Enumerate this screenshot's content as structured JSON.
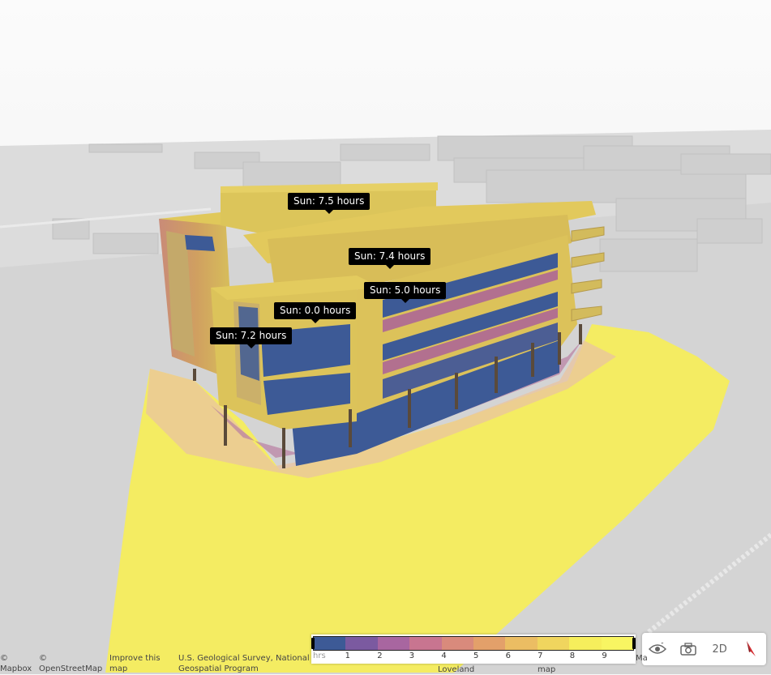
{
  "map": {
    "tooltips": [
      {
        "label": "Sun: 7.5 hours"
      },
      {
        "label": "Sun: 7.4 hours"
      },
      {
        "label": "Sun: 5.0 hours"
      },
      {
        "label": "Sun: 0.0 hours"
      },
      {
        "label": "Sun: 7.2 hours"
      }
    ]
  },
  "legend": {
    "unit": "hrs",
    "ticks": [
      "1",
      "2",
      "3",
      "4",
      "5",
      "6",
      "7",
      "8",
      "9"
    ],
    "colors": [
      "#3d5a96",
      "#7b5aa0",
      "#a866a0",
      "#c87590",
      "#d98a7c",
      "#e3a06a",
      "#ebbd63",
      "#f0d55e",
      "#f6ee5c",
      "#f8f562"
    ]
  },
  "controls": {
    "view_label": "2D",
    "icons": [
      "eye-icon",
      "camera-icon",
      "compass-icon"
    ]
  },
  "attribution": {
    "items": [
      "© Mapbox",
      "© OpenStreetMap",
      "Improve this map",
      "U.S. Geological Survey, National Geospatial Program",
      "Loveland",
      "map",
      "Ma"
    ]
  },
  "colors": {
    "facade": "#d8c25a",
    "shade": "#3d5a96",
    "ground_sun": "#f4ec62"
  }
}
